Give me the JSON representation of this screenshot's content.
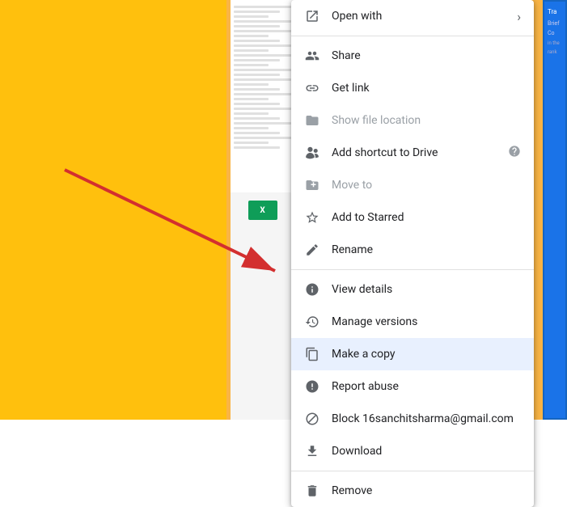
{
  "background": {
    "color": "#FFC107"
  },
  "context_menu": {
    "items": [
      {
        "id": "open-with",
        "label": "Open with",
        "icon": "open-with-icon",
        "has_arrow": true,
        "disabled": false
      },
      {
        "id": "share",
        "label": "Share",
        "icon": "share-icon",
        "has_arrow": false,
        "disabled": false
      },
      {
        "id": "get-link",
        "label": "Get link",
        "icon": "link-icon",
        "has_arrow": false,
        "disabled": false
      },
      {
        "id": "show-file-location",
        "label": "Show file location",
        "icon": "folder-icon",
        "has_arrow": false,
        "disabled": true
      },
      {
        "id": "add-shortcut",
        "label": "Add shortcut to Drive",
        "icon": "shortcut-icon",
        "has_arrow": false,
        "has_help": true,
        "disabled": false
      },
      {
        "id": "move-to",
        "label": "Move to",
        "icon": "move-icon",
        "has_arrow": false,
        "disabled": true
      },
      {
        "id": "add-starred",
        "label": "Add to Starred",
        "icon": "star-icon",
        "has_arrow": false,
        "disabled": false
      },
      {
        "id": "rename",
        "label": "Rename",
        "icon": "rename-icon",
        "has_arrow": false,
        "disabled": false
      },
      {
        "id": "view-details",
        "label": "View details",
        "icon": "info-icon",
        "has_arrow": false,
        "disabled": false
      },
      {
        "id": "manage-versions",
        "label": "Manage versions",
        "icon": "versions-icon",
        "has_arrow": false,
        "disabled": false
      },
      {
        "id": "make-copy",
        "label": "Make a copy",
        "icon": "copy-icon",
        "has_arrow": false,
        "disabled": false,
        "highlighted": true
      },
      {
        "id": "report-abuse",
        "label": "Report abuse",
        "icon": "report-icon",
        "has_arrow": false,
        "disabled": false
      },
      {
        "id": "block-user",
        "label": "Block 16sanchitsharma@gmail.com",
        "icon": "block-icon",
        "has_arrow": false,
        "disabled": false
      },
      {
        "id": "download",
        "label": "Download",
        "icon": "download-icon",
        "has_arrow": false,
        "disabled": false
      },
      {
        "id": "remove",
        "label": "Remove",
        "icon": "trash-icon",
        "has_arrow": false,
        "disabled": false
      }
    ]
  }
}
